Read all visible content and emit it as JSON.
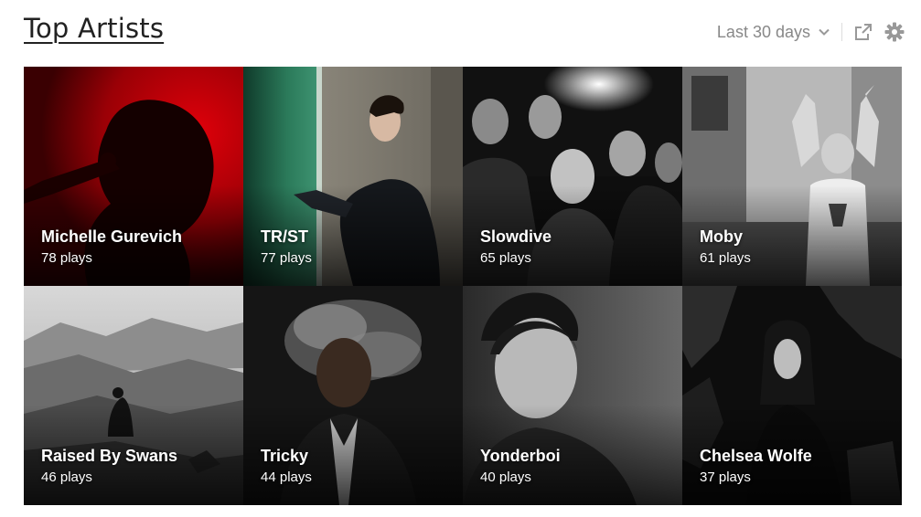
{
  "header": {
    "title": "Top Artists",
    "period_label": "Last 30 days"
  },
  "icons": {
    "period_dropdown": "chevron-down-icon",
    "share": "share-icon",
    "settings": "gear-icon"
  },
  "colors": {
    "title": "#222222",
    "muted": "#888888",
    "tile_text": "#ffffff"
  },
  "artists": [
    {
      "name": "Michelle Gurevich",
      "plays": "78 plays"
    },
    {
      "name": "TR/ST",
      "plays": "77 plays"
    },
    {
      "name": "Slowdive",
      "plays": "65 plays"
    },
    {
      "name": "Moby",
      "plays": "61 plays"
    },
    {
      "name": "Raised By Swans",
      "plays": "46 plays"
    },
    {
      "name": "Tricky",
      "plays": "44 plays"
    },
    {
      "name": "Yonderboi",
      "plays": "40 plays"
    },
    {
      "name": "Chelsea Wolfe",
      "plays": "37 plays"
    }
  ]
}
